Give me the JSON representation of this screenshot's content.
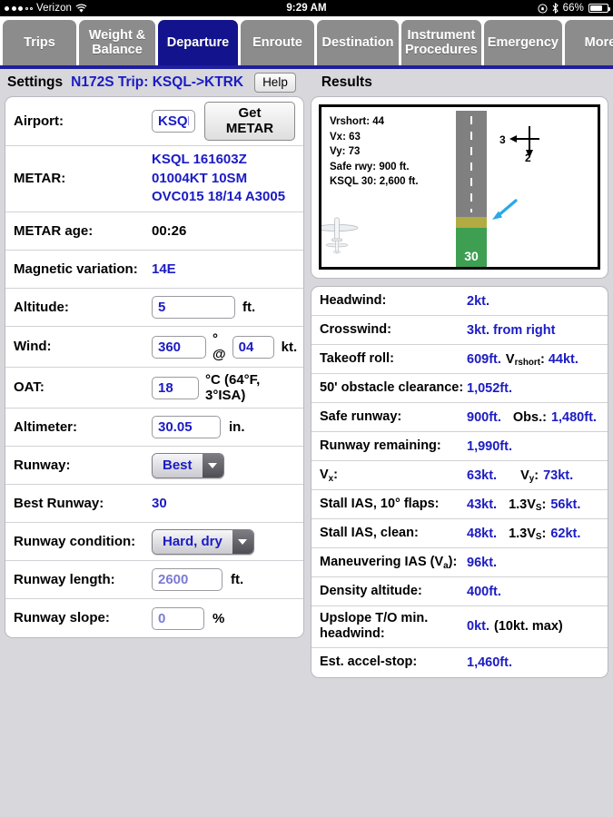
{
  "statusbar": {
    "carrier": "Verizon",
    "time": "9:29 AM",
    "battery_pct": "66%",
    "signal_filled": 3,
    "signal_hollow": 2,
    "wifi_icon": "wifi-icon",
    "rotation_lock_icon": "rotation-lock-icon",
    "bluetooth_icon": "bluetooth-icon",
    "battery_icon": "battery-icon"
  },
  "tabs": [
    {
      "label": "Trips",
      "active": false
    },
    {
      "label": "Weight & Balance",
      "active": false
    },
    {
      "label": "Departure",
      "active": true
    },
    {
      "label": "Enroute",
      "active": false
    },
    {
      "label": "Destination",
      "active": false
    },
    {
      "label": "Instrument Procedures",
      "active": false
    },
    {
      "label": "Emergency",
      "active": false
    },
    {
      "label": "More",
      "active": false
    }
  ],
  "header": {
    "settings_label": "Settings",
    "trip_label": "N172S Trip: KSQL->KTRK",
    "help_label": "Help",
    "results_label": "Results"
  },
  "settings": {
    "airport": {
      "label": "Airport:",
      "value": "KSQL",
      "get_metar_label": "Get METAR"
    },
    "metar": {
      "label": "METAR:",
      "value": "KSQL 161603Z 01004KT 10SM OVC015 18/14 A3005"
    },
    "metar_age": {
      "label": "METAR age:",
      "value": "00:26"
    },
    "magvar": {
      "label": "Magnetic variation:",
      "value": "14E"
    },
    "altitude": {
      "label": "Altitude:",
      "value": "5",
      "unit": "ft."
    },
    "wind": {
      "label": "Wind:",
      "direction": "360",
      "deg_unit": "° @",
      "speed": "04",
      "speed_unit": "kt."
    },
    "oat": {
      "label": "OAT:",
      "value": "18",
      "unit": "°C  (64°F,  3°ISA)"
    },
    "altimeter": {
      "label": "Altimeter:",
      "value": "30.05",
      "unit": "in."
    },
    "runway": {
      "label": "Runway:",
      "value": "Best"
    },
    "best_runway": {
      "label": "Best Runway:",
      "value": "30"
    },
    "runway_condition": {
      "label": "Runway condition:",
      "value": "Hard, dry"
    },
    "runway_length": {
      "label": "Runway length:",
      "value": "2600",
      "unit": "ft."
    },
    "runway_slope": {
      "label": "Runway slope:",
      "value": "0",
      "unit": "%"
    }
  },
  "diagram": {
    "info_lines": [
      "Vrshort: 44",
      "Vx: 63",
      "Vy: 73",
      "Safe rwy: 900 ft.",
      "KSQL 30: 2,600 ft."
    ],
    "runway_number": "30",
    "wind_cross": "3",
    "wind_head": "2",
    "colors": {
      "runway": "#808080",
      "displaced": "#b2ab43",
      "threshold": "#3e9e52",
      "arrow": "#2aa8e8"
    }
  },
  "results": [
    {
      "label": "Headwind:",
      "v1": "2kt.",
      "mid": "",
      "v2": ""
    },
    {
      "label": "Crosswind:",
      "v1": "3kt. from right",
      "mid": "",
      "v2": ""
    },
    {
      "label": "Takeoff roll:",
      "v1": "609ft.",
      "mid": "V",
      "mid_sub": "rshort",
      "mid_tail": ":",
      "v2": "44kt.",
      "tight": true
    },
    {
      "label": "50' obstacle clearance:",
      "v1": "1,052ft.",
      "mid": "",
      "v2": ""
    },
    {
      "label": "Safe runway:",
      "v1": "900ft.",
      "mid": "Obs.:",
      "v2": "1,480ft."
    },
    {
      "label": "Runway remaining:",
      "v1": "1,990ft.",
      "mid": "",
      "v2": ""
    },
    {
      "label_rich": "Vx:",
      "label_main": "V",
      "label_sub": "x",
      "label_tail": ":",
      "v1": "63kt.",
      "mid": "V",
      "mid_sub": "y",
      "mid_tail": ":",
      "v2": "73kt."
    },
    {
      "label": "Stall IAS, 10° flaps:",
      "v1": "43kt.",
      "mid": "1.3V",
      "mid_sub": "S",
      "mid_tail": ":",
      "v2": "56kt."
    },
    {
      "label": "Stall IAS, clean:",
      "v1": "48kt.",
      "mid": "1.3V",
      "mid_sub": "S",
      "mid_tail": ":",
      "v2": "62kt."
    },
    {
      "label_main": "Maneuvering IAS (V",
      "label_sub": "a",
      "label_tail": "):",
      "v1": "96kt.",
      "mid": "",
      "v2": ""
    },
    {
      "label": "Density altitude:",
      "v1": "400ft.",
      "mid": "",
      "v2": ""
    },
    {
      "label": "Upslope T/O min. headwind:",
      "v1": "0kt.",
      "mid": "(10kt. max)",
      "v2": "",
      "mid_black": true,
      "tight": true
    },
    {
      "label": "Est. accel-stop:",
      "v1": "1,460ft.",
      "mid": "",
      "v2": ""
    }
  ],
  "colors": {
    "accent_blue": "#1b1bc4",
    "tab_active": "#13138e",
    "tab_inactive": "#8c8c8c",
    "page_bg": "#d7d7dc"
  }
}
